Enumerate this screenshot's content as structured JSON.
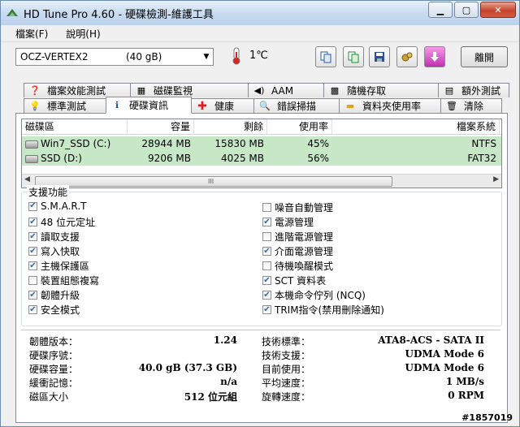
{
  "window": {
    "title": "HD Tune Pro 4.60 - 硬碟檢測-維護工具"
  },
  "menu": [
    "檔案(F)",
    "說明(H)"
  ],
  "toolbar": {
    "drive_name": "OCZ-VERTEX2",
    "drive_size": "(40 gB)",
    "temperature": "1℃",
    "exit_label": "離開"
  },
  "tabs_row1": [
    "檔案效能測試",
    "磁碟監視",
    "AAM",
    "隨機存取",
    "額外測試"
  ],
  "tabs_row2": [
    "標準測試",
    "硬碟資訊",
    "健康",
    "錯誤掃描",
    "資料夾使用率",
    "清除"
  ],
  "active_tab": "硬碟資訊",
  "partitions": {
    "headers": [
      "磁碟區",
      "容量",
      "剩餘",
      "使用率",
      "檔案系統"
    ],
    "rows": [
      {
        "volume": "Win7_SSD (C:)",
        "capacity": "28944 MB",
        "free": "15830 MB",
        "usage": "45%",
        "fs": "NTFS"
      },
      {
        "volume": "SSD (D:)",
        "capacity": "9206 MB",
        "free": "4025 MB",
        "usage": "56%",
        "fs": "FAT32"
      }
    ],
    "scroll_grip": "III"
  },
  "features": {
    "label": "支援功能",
    "left": [
      {
        "label": "S.M.A.R.T",
        "checked": true
      },
      {
        "label": "48 位元定址",
        "checked": true
      },
      {
        "label": "讀取支援",
        "checked": true
      },
      {
        "label": "寫入快取",
        "checked": true
      },
      {
        "label": "主機保護區",
        "checked": true
      },
      {
        "label": "裝置組態複寫",
        "checked": false
      },
      {
        "label": "韌體升級",
        "checked": true
      },
      {
        "label": "安全模式",
        "checked": true
      }
    ],
    "right": [
      {
        "label": "噪音自動管理",
        "checked": false
      },
      {
        "label": "電源管理",
        "checked": true
      },
      {
        "label": "進階電源管理",
        "checked": false
      },
      {
        "label": "介面電源管理",
        "checked": true
      },
      {
        "label": "待機喚醒模式",
        "checked": false
      },
      {
        "label": "SCT 資料表",
        "checked": true
      },
      {
        "label": "本機命令佇列 (NCQ)",
        "checked": true
      },
      {
        "label": "TRIM指令(禁用刪除通知)",
        "checked": true
      }
    ]
  },
  "info": {
    "left": [
      {
        "label": "韌體版本：",
        "value": "1.24"
      },
      {
        "label": "硬碟序號：",
        "value": ""
      },
      {
        "label": "硬碟容量：",
        "value": "40.0 gB (37.3 GB)"
      },
      {
        "label": "緩衝記憶：",
        "value": "n/a"
      },
      {
        "label": "磁區大小",
        "value": "512 位元組"
      }
    ],
    "right": [
      {
        "label": "技術標準：",
        "value": "ATA8-ACS - SATA II"
      },
      {
        "label": "技術支援：",
        "value": "UDMA Mode 6"
      },
      {
        "label": "目前使用：",
        "value": "UDMA Mode 6"
      },
      {
        "label": "平均速度：",
        "value": "1 MB/s"
      },
      {
        "label": "旋轉速度：",
        "value": "0 RPM"
      }
    ]
  },
  "watermark": "#1857019",
  "colors": {
    "row_highlight": "#c6e8c6",
    "title_gradient": "#c9dcf0",
    "close_button": "#c6452c"
  }
}
